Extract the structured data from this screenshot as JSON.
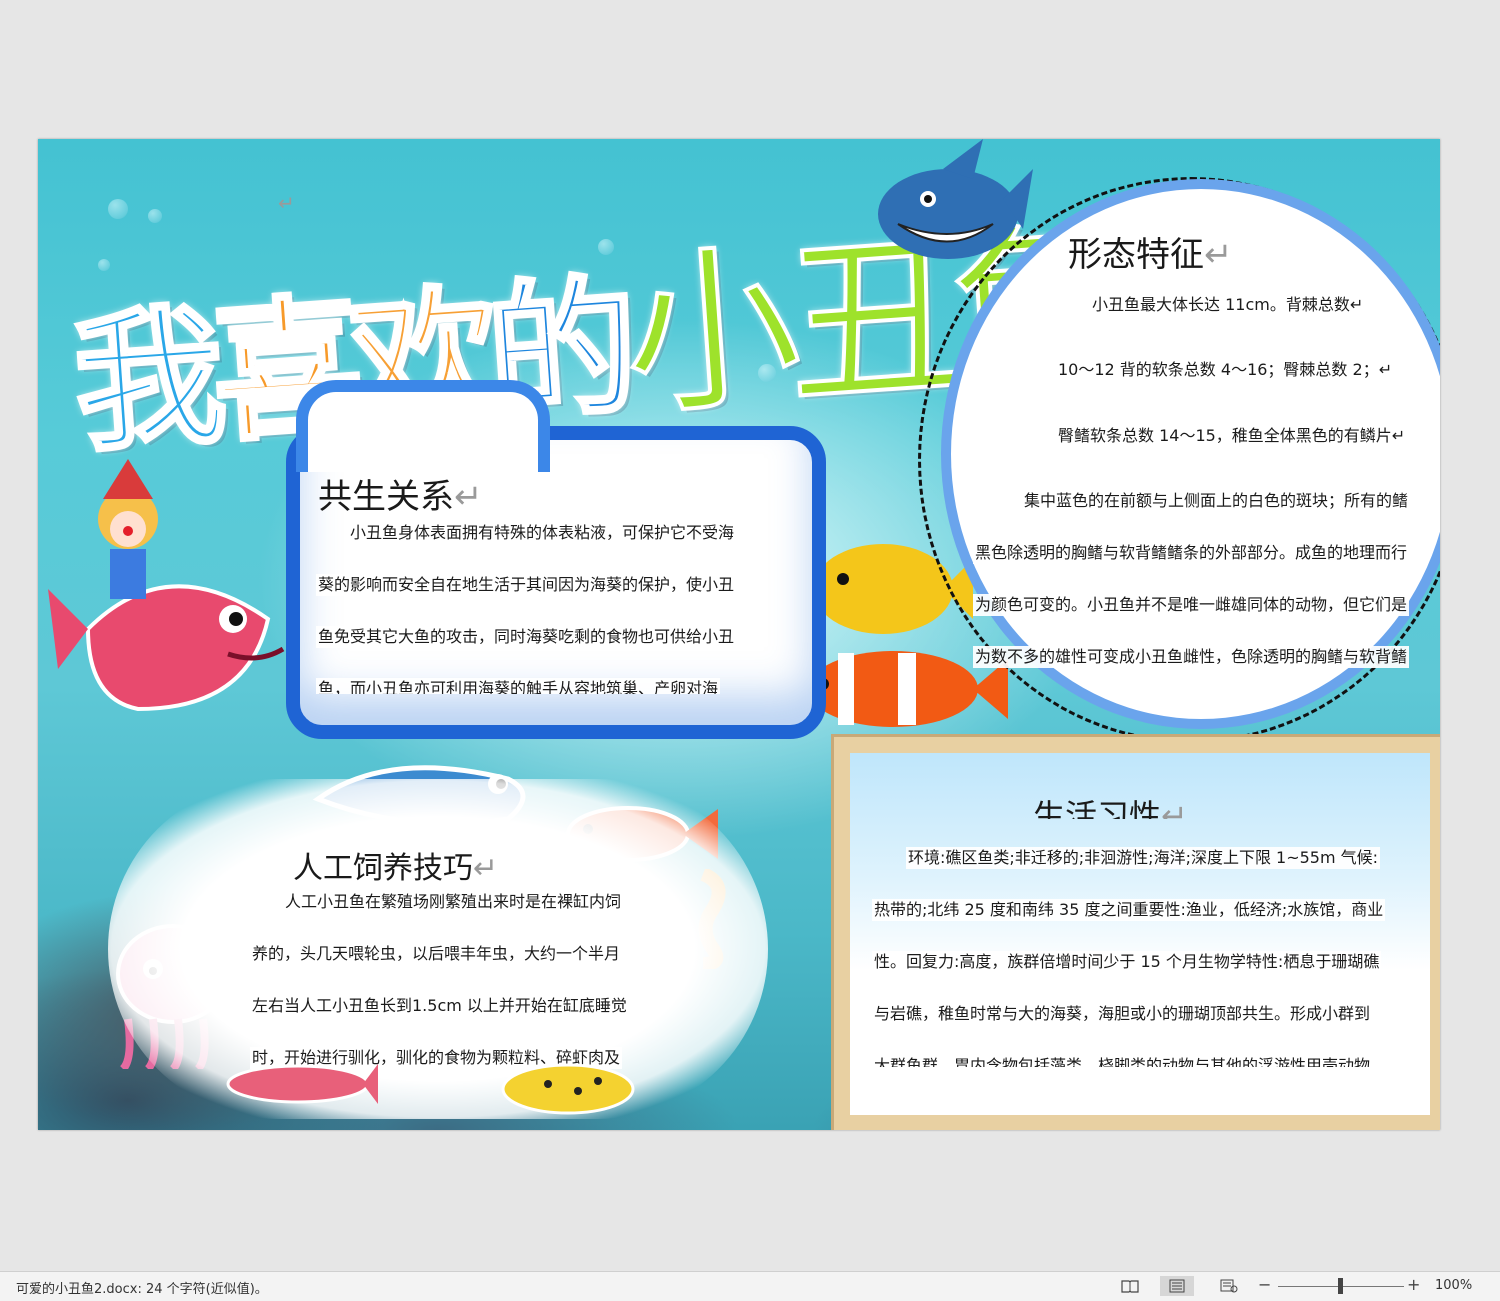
{
  "document": {
    "title_chars": [
      "我",
      "喜",
      "欢",
      "的",
      "小",
      "丑",
      "鱼"
    ],
    "return_mark": "↵"
  },
  "sections": {
    "symbiosis": {
      "heading": "共生关系",
      "lines": [
        "小丑鱼身体表面拥有特殊的体表粘液，可保护它不受海",
        "葵的影响而安全自在地生活于其间因为海葵的保护，使小丑",
        "鱼免受其它大鱼的攻击，同时海葵吃剩的食物也可供给小丑",
        "鱼，而小丑鱼亦可利用海葵的触手从容地筑巢、产卵对海"
      ]
    },
    "morphology": {
      "heading": "形态特征",
      "lines": [
        "小丑鱼最大体长达 11cm。背棘总数↵",
        "10～12 背的软条总数 4～16；臀棘总数 2；↵",
        "臀鳍软条总数 14～15，稚鱼全体黑色的有鳞片↵",
        "集中蓝色的在前额与上侧面上的白色的斑块；所有的鳍",
        "黑色除透明的胸鳍与软背鳍鳍条的外部部分。成鱼的地理而行",
        "为颜色可变的。小丑鱼并不是唯一雌雄同体的动物，但它们是",
        "为数不多的雄性可变成小丑鱼雌性，色除透明的胸鳍与软背鳍"
      ]
    },
    "habits": {
      "heading": "生活习性",
      "lines": [
        "环境:礁区鱼类;非迁移的;非洄游性;海洋;深度上下限  1~55m  气候:",
        "热带的;北纬 25 度和南纬 35 度之间重要性:渔业，低经济;水族馆，商业",
        "性。回复力:高度，族群倍增时间少于 15 个月生物学特性:栖息于珊瑚礁",
        "与岩礁，稚鱼时常与大的海葵，海胆或小的珊瑚顶部共生。形成小群到",
        "大群鱼群，胃内含物包括藻类、桡脚类的动物与其他的浮游性甲壳动物"
      ]
    },
    "feeding": {
      "heading": "人工饲养技巧",
      "lines": [
        "人工小丑鱼在繁殖场刚繁殖出来时是在裸缸内饲",
        "养的，头几天喂轮虫，以后喂丰年虫，大约一个半月",
        "左右当人工小丑鱼长到1.5cm  以上并开始在缸底睡觉",
        "时，开始进行驯化，驯化的食物为颗粒料、碎虾肉及"
      ]
    }
  },
  "statusbar": {
    "doc_info": "可爱的小丑鱼2.docx: 24 个字符(近似值)。",
    "zoom_minus": "−",
    "zoom_plus": "+",
    "zoom_level": "100%",
    "view_icons": [
      "read-mode-icon",
      "print-layout-icon",
      "web-layout-icon"
    ]
  }
}
